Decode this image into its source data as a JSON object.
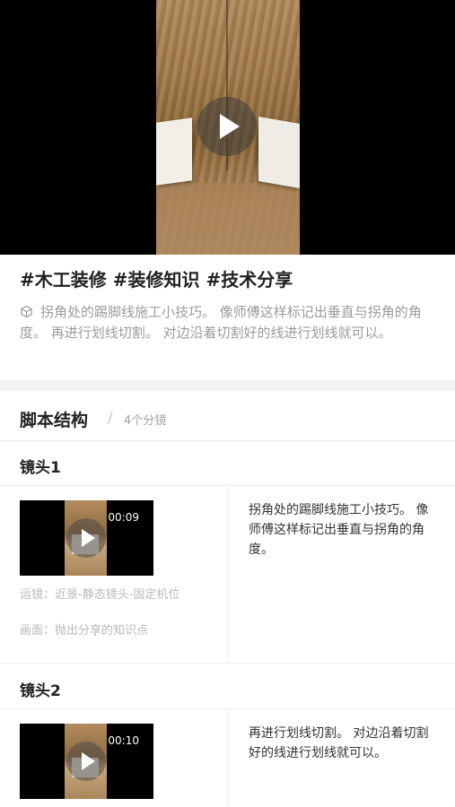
{
  "video": {
    "play_icon": "play-icon"
  },
  "post": {
    "title": "#木工装修 #装修知识 #技术分享",
    "icon": "cube-icon",
    "description": "拐角处的踢脚线施工小技巧。 像师傅这样标记出垂直与拐角的角度。 再进行划线切割。 对边沿着切割好的线进行划线就可以。"
  },
  "script_section": {
    "title": "脚本结构",
    "separator": "/",
    "count": "4个分镜"
  },
  "shots": [
    {
      "label": "镜头1",
      "duration": "00:09",
      "camera": "运镜：近景-静态镜头-固定机位",
      "scene": "画面：抛出分享的知识点",
      "text": "拐角处的踢脚线施工小技巧。 像师傅这样标记出垂直与拐角的角度。"
    },
    {
      "label": "镜头2",
      "duration": "00:10",
      "text": "再进行划线切割。 对边沿着切割好的线进行划线就可以。"
    }
  ]
}
